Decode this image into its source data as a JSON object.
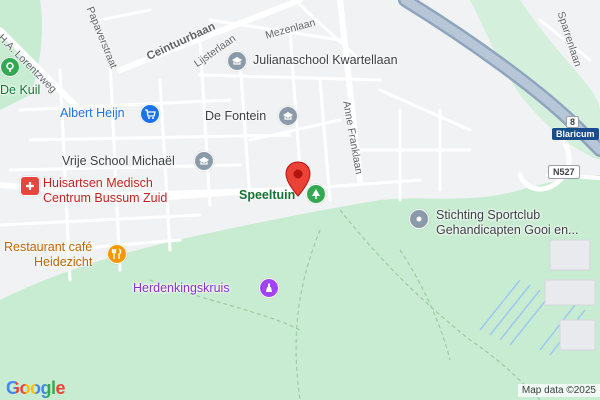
{
  "map": {
    "streets": {
      "lorentzweg": "H.A. Lorentzweg",
      "papaverstraat": "Papaverstraat",
      "ceintuurbaan": "Ceintuurbaan",
      "mezenlaan": "Mezenlaan",
      "lijsterlaan": "Lijsterlaan",
      "anne_franklaan": "Anne Franklaan",
      "sparrenlaan": "Sparrenlaan"
    },
    "places": {
      "de_kuil": "De Kuil",
      "julianaschool": "Julianaschool Kwartellaan",
      "albert_heijn": "Albert Heijn",
      "de_fontein": "De Fontein",
      "vrije_school": "Vrije School Michaël",
      "huisartsen_line1": "Huisartsen Medisch",
      "huisartsen_line2": "Centrum Bussum Zuid",
      "speeltuin": "Speeltuin",
      "sportclub_line1": "Stichting Sportclub",
      "sportclub_line2": "Gehandicapten Gooi en...",
      "restaurant_line1": "Restaurant café",
      "restaurant_line2": "Heidezicht",
      "herdenkingskruis": "Herdenkingskruis"
    },
    "road_shields": {
      "route_8": "8",
      "blaricum": "Blaricum",
      "n527": "N527"
    },
    "attribution": "Map data ©2025",
    "logo": "Google",
    "colors": {
      "background": "#f1f2f4",
      "park": "#c8ecd2",
      "highway": "#8fa5bd",
      "school_icon": "#8a9aa8",
      "shop_icon": "#1a73e8",
      "medical_icon": "#e8453c",
      "restaurant_icon": "#f29900",
      "park_icon": "#34a853",
      "monument_icon": "#a142f4",
      "marker": "#ea4335"
    }
  }
}
